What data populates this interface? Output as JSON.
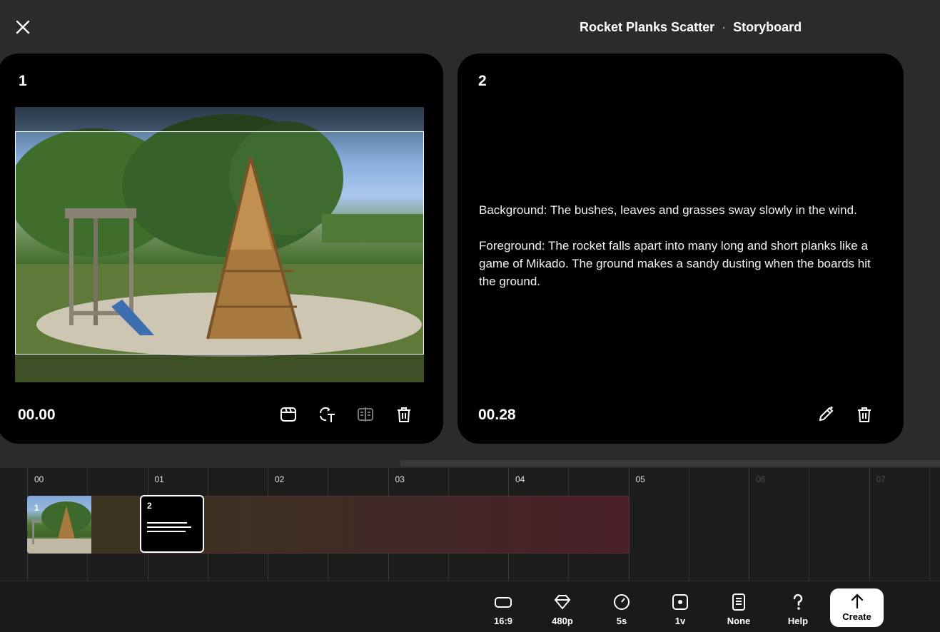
{
  "header": {
    "project_name": "Rocket Planks Scatter",
    "separator": "·",
    "view_name": "Storyboard"
  },
  "scenes": [
    {
      "number": "1",
      "time": "00.00",
      "type": "image",
      "actions": [
        "camera-icon",
        "text-transform-icon",
        "compare-icon",
        "trash-icon"
      ]
    },
    {
      "number": "2",
      "time": "00.28",
      "type": "text",
      "paragraphs": [
        "Background: The bushes, leaves and grasses sway slowly in the wind.",
        "Foreground: The rocket falls apart into many long and short planks like a game of Mikado. The ground makes a sandy dusting when the boards hit the ground."
      ],
      "actions": [
        "edit-pencil-icon",
        "trash-icon"
      ]
    }
  ],
  "timeline": {
    "ticks": [
      "00",
      "01",
      "02",
      "03",
      "04",
      "05",
      "06",
      "07"
    ],
    "active_until": 5,
    "clips": [
      {
        "number": "1",
        "type": "image"
      },
      {
        "number": "2",
        "type": "text"
      }
    ]
  },
  "toolbar": {
    "items": [
      {
        "label": "16:9",
        "icon": "aspect-ratio-icon"
      },
      {
        "label": "480p",
        "icon": "diamond-quality-icon"
      },
      {
        "label": "5s",
        "icon": "duration-icon"
      },
      {
        "label": "1v",
        "icon": "variations-icon"
      },
      {
        "label": "None",
        "icon": "style-preset-icon"
      },
      {
        "label": "Help",
        "icon": "help-icon"
      }
    ],
    "create_label": "Create"
  }
}
